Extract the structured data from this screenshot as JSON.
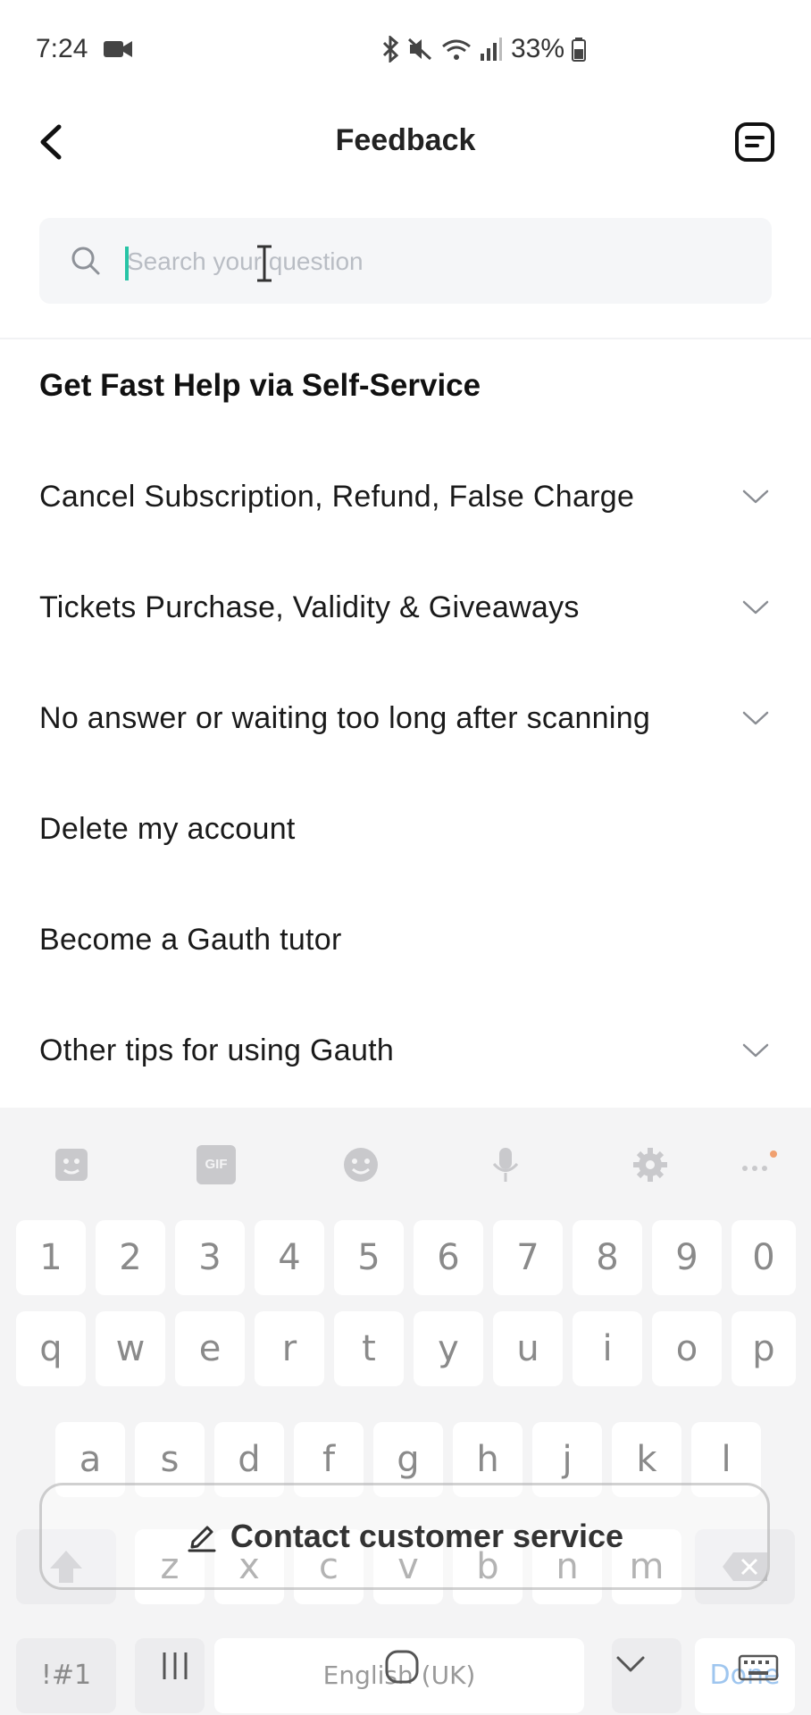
{
  "status_bar": {
    "time": "7:24",
    "battery": "33%"
  },
  "header": {
    "title": "Feedback"
  },
  "search": {
    "placeholder": "Search your question",
    "value": ""
  },
  "section": {
    "title": "Get Fast Help via Self-Service"
  },
  "faq": [
    {
      "label": "Cancel Subscription, Refund, False Charge",
      "expandable": true
    },
    {
      "label": "Tickets Purchase, Validity & Giveaways",
      "expandable": true
    },
    {
      "label": "No answer or waiting too long after scanning",
      "expandable": true
    },
    {
      "label": "Delete my account",
      "expandable": false
    },
    {
      "label": "Become a Gauth tutor",
      "expandable": false
    },
    {
      "label": "Other tips for using Gauth",
      "expandable": true
    }
  ],
  "contact_button": {
    "label": "Contact customer service"
  },
  "keyboard": {
    "row_numbers": [
      "1",
      "2",
      "3",
      "4",
      "5",
      "6",
      "7",
      "8",
      "9",
      "0"
    ],
    "row1": [
      "q",
      "w",
      "e",
      "r",
      "t",
      "y",
      "u",
      "i",
      "o",
      "p"
    ],
    "row2": [
      "a",
      "s",
      "d",
      "f",
      "g",
      "h",
      "j",
      "k",
      "l"
    ],
    "row3": [
      "z",
      "x",
      "c",
      "v",
      "b",
      "n",
      "m"
    ],
    "symbols_label": "!#1",
    "space_label": "English (UK)",
    "done_label": "Done",
    "gif_label": "GIF"
  },
  "colors": {
    "accent": "#27c4a6",
    "search_bg": "#f5f6f8",
    "keyboard_bg": "#f4f4f5"
  }
}
